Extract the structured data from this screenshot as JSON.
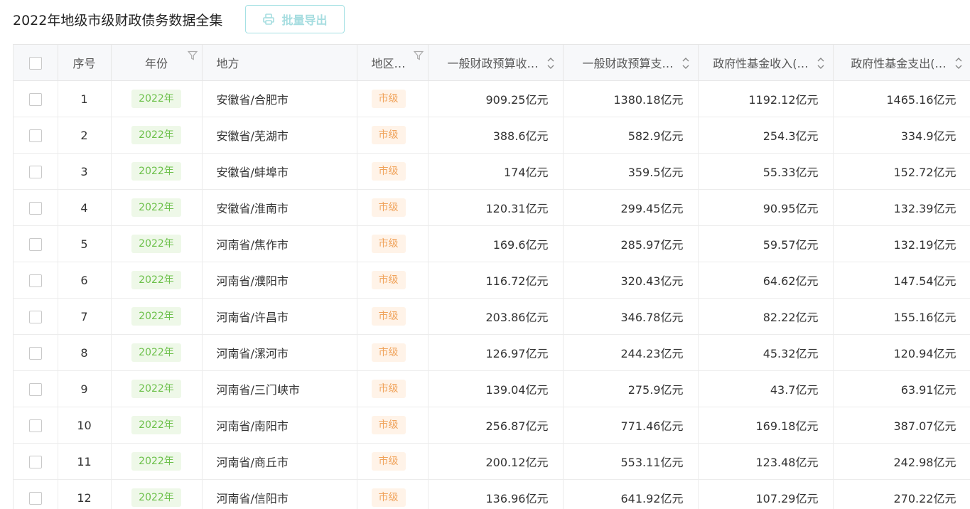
{
  "page": {
    "title": "2022年地级市级财政债务数据全集",
    "export_label": "批量导出"
  },
  "table": {
    "headers": {
      "index": "序号",
      "year": "年份",
      "region": "地方",
      "level": "地区…",
      "gen_rev": "一般财政预算收…",
      "gen_exp": "一般财政预算支…",
      "fund_rev": "政府性基金收入(…",
      "fund_exp": "政府性基金支出(…"
    },
    "rows": [
      {
        "index": "1",
        "year": "2022年",
        "region": "安徽省/合肥市",
        "level": "市级",
        "gen_rev": "909.25亿元",
        "gen_exp": "1380.18亿元",
        "fund_rev": "1192.12亿元",
        "fund_exp": "1465.16亿元"
      },
      {
        "index": "2",
        "year": "2022年",
        "region": "安徽省/芜湖市",
        "level": "市级",
        "gen_rev": "388.6亿元",
        "gen_exp": "582.9亿元",
        "fund_rev": "254.3亿元",
        "fund_exp": "334.9亿元"
      },
      {
        "index": "3",
        "year": "2022年",
        "region": "安徽省/蚌埠市",
        "level": "市级",
        "gen_rev": "174亿元",
        "gen_exp": "359.5亿元",
        "fund_rev": "55.33亿元",
        "fund_exp": "152.72亿元"
      },
      {
        "index": "4",
        "year": "2022年",
        "region": "安徽省/淮南市",
        "level": "市级",
        "gen_rev": "120.31亿元",
        "gen_exp": "299.45亿元",
        "fund_rev": "90.95亿元",
        "fund_exp": "132.39亿元"
      },
      {
        "index": "5",
        "year": "2022年",
        "region": "河南省/焦作市",
        "level": "市级",
        "gen_rev": "169.6亿元",
        "gen_exp": "285.97亿元",
        "fund_rev": "59.57亿元",
        "fund_exp": "132.19亿元"
      },
      {
        "index": "6",
        "year": "2022年",
        "region": "河南省/濮阳市",
        "level": "市级",
        "gen_rev": "116.72亿元",
        "gen_exp": "320.43亿元",
        "fund_rev": "64.62亿元",
        "fund_exp": "147.54亿元"
      },
      {
        "index": "7",
        "year": "2022年",
        "region": "河南省/许昌市",
        "level": "市级",
        "gen_rev": "203.86亿元",
        "gen_exp": "346.78亿元",
        "fund_rev": "82.22亿元",
        "fund_exp": "155.16亿元"
      },
      {
        "index": "8",
        "year": "2022年",
        "region": "河南省/漯河市",
        "level": "市级",
        "gen_rev": "126.97亿元",
        "gen_exp": "244.23亿元",
        "fund_rev": "45.32亿元",
        "fund_exp": "120.94亿元"
      },
      {
        "index": "9",
        "year": "2022年",
        "region": "河南省/三门峡市",
        "level": "市级",
        "gen_rev": "139.04亿元",
        "gen_exp": "275.9亿元",
        "fund_rev": "43.7亿元",
        "fund_exp": "63.91亿元"
      },
      {
        "index": "10",
        "year": "2022年",
        "region": "河南省/南阳市",
        "level": "市级",
        "gen_rev": "256.87亿元",
        "gen_exp": "771.46亿元",
        "fund_rev": "169.18亿元",
        "fund_exp": "387.07亿元"
      },
      {
        "index": "11",
        "year": "2022年",
        "region": "河南省/商丘市",
        "level": "市级",
        "gen_rev": "200.12亿元",
        "gen_exp": "553.11亿元",
        "fund_rev": "123.48亿元",
        "fund_exp": "242.98亿元"
      },
      {
        "index": "12",
        "year": "2022年",
        "region": "河南省/信阳市",
        "level": "市级",
        "gen_rev": "136.96亿元",
        "gen_exp": "641.92亿元",
        "fund_rev": "107.29亿元",
        "fund_exp": "270.22亿元"
      }
    ]
  },
  "icons": {
    "export": "printer-icon",
    "filter": "filter-icon",
    "sort": "sort-icon",
    "checkbox": "checkbox-icon"
  },
  "colors": {
    "year_tag_text": "#6cc04a",
    "year_tag_bg": "#eef8e8",
    "level_tag_text": "#f0a35b",
    "level_tag_bg": "#fff3e8",
    "export_accent": "#a6dde0",
    "header_bg": "#f7f8fa"
  }
}
